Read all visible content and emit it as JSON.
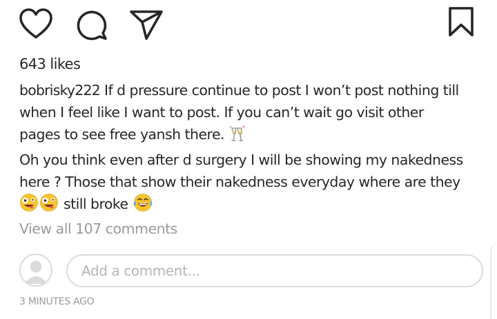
{
  "actions": {
    "like": "heart-icon",
    "comment": "comment-icon",
    "share": "direct-send-icon",
    "save": "bookmark-icon"
  },
  "likes": "643 likes",
  "caption": {
    "username": "bobrisky222",
    "line1": " If d pressure continue to post I won’t post nothing till",
    "line2": "when I feel like I want to post. If you can’t wait go visit other",
    "line3": "pages to see free yansh there. ",
    "line4": "Oh you think even after d surgery I will be showing my nakedness",
    "line5": "here ? Those that show their nakedness everyday where are they",
    "line6_text": " still broke ",
    "emojis": [
      "clinking-glasses-emoji",
      "zany-face-emoji",
      "zany-face-emoji",
      "tears-of-joy-emoji"
    ]
  },
  "view_comments": "View all 107 comments",
  "comment_input": {
    "placeholder": "Add a comment..."
  },
  "timestamp": "3 MINUTES AGO",
  "colors": {
    "text": "#262626",
    "muted": "#9a9a9a",
    "border": "#dcdcdc"
  }
}
